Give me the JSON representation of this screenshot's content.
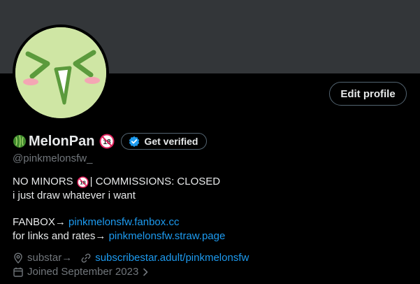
{
  "profile": {
    "display_name": "MelonPan",
    "handle": "@pinkmelonsfw_",
    "edit_profile_label": "Edit profile",
    "get_verified_label": "Get verified"
  },
  "bio": {
    "line1_a": "NO MINORS",
    "line1_b": "| COMMISSIONS: CLOSED",
    "line2": "i just draw whatever i want",
    "line3_prefix": "FANBOX→ ",
    "line3_link": "pinkmelonsfw.fanbox.cc",
    "line4_prefix": "for links and rates→ ",
    "line4_link": "pinkmelonsfw.straw.page"
  },
  "meta": {
    "location": "substar→",
    "website": "subscribestar.adult/pinkmelonsfw",
    "joined": "Joined September 2023"
  },
  "colors": {
    "background": "#000000",
    "banner": "#333639",
    "accent": "#1d9bf0",
    "muted": "#71767b",
    "avatar_bg": "#cfe6a4"
  },
  "icons": {
    "name_emoji": "melon-icon",
    "adult": "no-under-18-icon",
    "verified": "verified-badge-icon",
    "location": "location-pin-icon",
    "link": "link-icon",
    "calendar": "calendar-icon",
    "chevron": "chevron-right-icon"
  }
}
